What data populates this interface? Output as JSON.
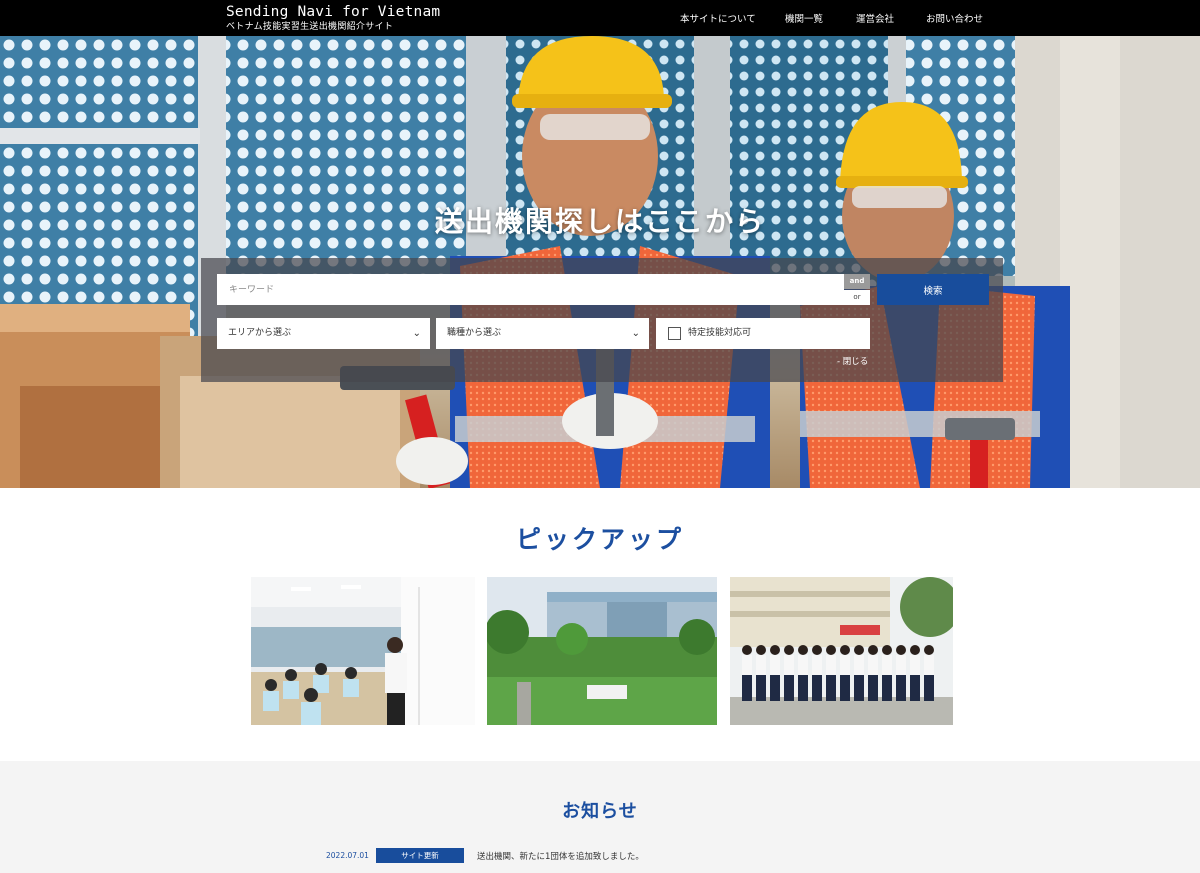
{
  "header": {
    "site_title": "Sending Navi for Vietnam",
    "site_subtitle": "ベトナム技能実習生送出機関紹介サイト",
    "nav": [
      {
        "label": "本サイトについて"
      },
      {
        "label": "機関一覧"
      },
      {
        "label": "運営会社"
      },
      {
        "label": "お問い合わせ"
      }
    ]
  },
  "hero": {
    "heading": "送出機関探しはここから",
    "search": {
      "keyword_placeholder": "キーワード",
      "and_label": "and",
      "or_label": "or",
      "button_label": "検索",
      "area_select": "エリアから選ぶ",
      "job_select": "職種から選ぶ",
      "checkbox_label": "特定技能対応可",
      "close_label": "- 閉じる"
    }
  },
  "pickup": {
    "heading": "ピックアップ"
  },
  "news": {
    "heading": "お知らせ",
    "items": [
      {
        "date": "2022.07.01",
        "tag": "サイト更新",
        "text": "送出機関、新たに1団体を追加致しました。"
      }
    ]
  },
  "colors": {
    "brand_blue": "#184d9c",
    "heading_blue": "#1c4fa0",
    "header_bg": "#000000",
    "news_bg": "#f4f4f4"
  }
}
